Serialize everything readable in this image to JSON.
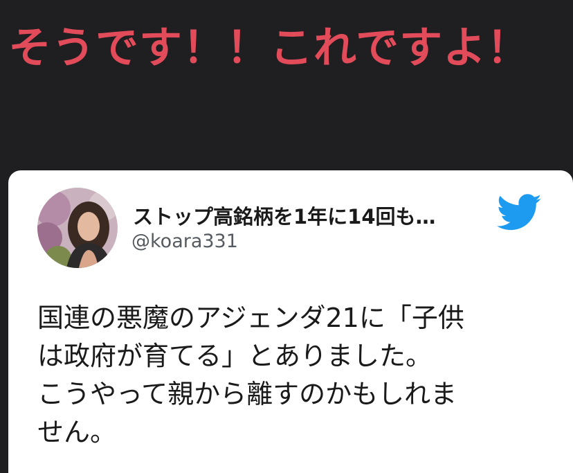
{
  "headline": "そうです！！これですよ！",
  "tweet": {
    "display_name": "ストップ高銘柄を1年に14回も…",
    "handle": "@koara331",
    "text": "国連の悪魔のアジェンダ21に「子供\nは政府が育てる」とありました。\nこうやって親から離すのかもしれま\nせん。",
    "logo_icon": "twitter-bird-icon",
    "logo_color": "#1d9bf0"
  },
  "colors": {
    "background": "#1f1e20",
    "headline": "#e24b5a",
    "card": "#ffffff"
  }
}
